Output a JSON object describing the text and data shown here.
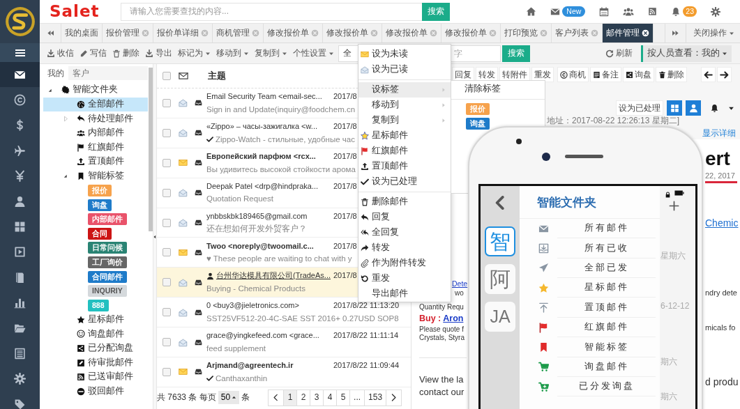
{
  "nav_rail": {
    "items": [
      {
        "selected": true
      },
      {
        "selected": false
      },
      {
        "selected": false
      },
      {
        "selected": false
      },
      {
        "selected": false
      },
      {
        "selected": false
      },
      {
        "selected": false
      },
      {
        "selected": false
      },
      {
        "selected": false
      },
      {
        "selected": false
      },
      {
        "selected": false
      },
      {
        "selected": false
      },
      {
        "selected": false
      },
      {
        "selected": false
      }
    ]
  },
  "header": {
    "logo": "Salet",
    "search": {
      "placeholder": "请输入您需要查找的内容...",
      "button": "搜索"
    },
    "mail_badge": "New",
    "notification_badge": "23"
  },
  "tabs": {
    "items": [
      {
        "label": "我的桌面",
        "closable": false,
        "selected": false
      },
      {
        "label": "报价管理",
        "closable": true,
        "selected": false
      },
      {
        "label": "报价单详细",
        "closable": true,
        "selected": false
      },
      {
        "label": "商机管理",
        "closable": true,
        "selected": false
      },
      {
        "label": "修改报价单",
        "closable": true,
        "selected": false
      },
      {
        "label": "修改报价单",
        "closable": true,
        "selected": false
      },
      {
        "label": "修改报价单",
        "closable": true,
        "selected": false
      },
      {
        "label": "修改报价单",
        "closable": true,
        "selected": false
      },
      {
        "label": "打印预览",
        "closable": true,
        "selected": false
      },
      {
        "label": "客户列表",
        "closable": true,
        "selected": false
      },
      {
        "label": "邮件管理",
        "closable": true,
        "selected": true
      }
    ],
    "menu": "关闭操作"
  },
  "toolbar": {
    "actions": [
      {
        "label": "收信",
        "kind": "icon"
      },
      {
        "label": "写信",
        "kind": "icon"
      },
      {
        "label": "删除",
        "kind": "icon"
      },
      {
        "label": "导出",
        "kind": "icon"
      },
      {
        "label": "标记为",
        "kind": "dropdown"
      },
      {
        "label": "移动到",
        "kind": "dropdown"
      },
      {
        "label": "复制到",
        "kind": "dropdown"
      },
      {
        "label": "个性设置",
        "kind": "dropdown"
      }
    ],
    "scope": "全",
    "search_placeholder": "字",
    "search_button": "搜索",
    "refresh": "刷新",
    "view_filter": "按人员查看：我的"
  },
  "folder_panel": {
    "tabs": [
      {
        "label": "我的",
        "selected": true
      },
      {
        "label": "客户",
        "selected": false
      }
    ],
    "tree": [
      {
        "label": "智能文件夹",
        "kind": "folder",
        "expanded": true,
        "selected": false,
        "children": [
          {
            "label": "全部邮件",
            "kind": "folder",
            "selected": true
          },
          {
            "label": "待处理邮件",
            "kind": "folder",
            "expanded": false,
            "selected": false
          },
          {
            "label": "内部邮件",
            "kind": "folder",
            "selected": false
          },
          {
            "label": "红旗邮件",
            "kind": "folder",
            "selected": false
          },
          {
            "label": "置顶邮件",
            "kind": "folder",
            "selected": false
          },
          {
            "label": "智能标签",
            "kind": "folder",
            "expanded": true,
            "selected": false,
            "children": [
              {
                "label": "报价",
                "kind": "tag",
                "color": "#f6a24c",
                "selected": false
              },
              {
                "label": "询盘",
                "kind": "tag",
                "color": "#1e7bc9",
                "selected": false
              },
              {
                "label": "内部邮件",
                "kind": "tag",
                "color": "#e9536a",
                "selected": false
              },
              {
                "label": "合同",
                "kind": "tag",
                "color": "#cc1414",
                "selected": false
              },
              {
                "label": "日常问候",
                "kind": "tag",
                "color": "#2a8474",
                "selected": false
              },
              {
                "label": "工厂询价",
                "kind": "tag",
                "color": "#666666",
                "selected": false
              },
              {
                "label": "合同邮件",
                "kind": "tag",
                "color": "#1e7bc9",
                "selected": false
              },
              {
                "label": "INQURIY",
                "kind": "tag",
                "color": "#d5d9dc",
                "selected": false
              },
              {
                "label": "888",
                "kind": "tag",
                "color": "#22c0c0",
                "selected": false
              }
            ]
          },
          {
            "label": "星标邮件",
            "kind": "folder",
            "selected": false
          },
          {
            "label": "询盘邮件",
            "kind": "folder",
            "selected": false
          },
          {
            "label": "已分配询盘",
            "kind": "folder",
            "selected": false
          },
          {
            "label": "待审批邮件",
            "kind": "folder",
            "selected": false
          },
          {
            "label": "已送审邮件",
            "kind": "folder",
            "selected": false
          },
          {
            "label": "驳回邮件",
            "kind": "folder",
            "selected": false
          }
        ]
      }
    ]
  },
  "email_list": {
    "header": "主题",
    "header_checkbox": {
      "checked": false
    },
    "rows": [
      {
        "sender": "Email Security Team <email-sec...",
        "date": "2017/8",
        "preview": "Sign in and Update(inquiry@foodchem.cn",
        "unread": false,
        "processed": false,
        "contact": false,
        "checked": false,
        "selected": false
      },
      {
        "sender": "«Zippo» – часы-зажигалка <w...",
        "date": "2017/8",
        "preview": "Zippo-Watch - стильные, удобные час",
        "unread": false,
        "processed": true,
        "contact": false,
        "checked": false,
        "selected": false
      },
      {
        "sender": "Европейский парфюм <rcx...",
        "date": "2017/8",
        "preview": "Вы удивитесь высокой стойкости арома",
        "unread": true,
        "processed": false,
        "contact": false,
        "checked": false,
        "selected": false
      },
      {
        "sender": "Deepak Patel <drp@hindpraka...",
        "date": "2017/8",
        "preview": "Quotation Request",
        "unread": false,
        "processed": false,
        "contact": false,
        "checked": false,
        "selected": false
      },
      {
        "sender": "ynbbskbk189465@gmail.com",
        "date": "2017/8",
        "preview": "还在想如何开发外贸客户？",
        "unread": false,
        "processed": false,
        "contact": false,
        "checked": false,
        "selected": false
      },
      {
        "sender": "Twoo <noreply@twoomail.c...",
        "date": "2017/8",
        "preview": "♥ These people are waiting to chat with y",
        "unread": true,
        "processed": false,
        "contact": false,
        "checked": false,
        "selected": false
      },
      {
        "sender": "台州华达模具有限公司(TradeAs...",
        "date": "2017/8",
        "preview": "Buying - Chemical Products",
        "unread": false,
        "processed": false,
        "contact": true,
        "checked": false,
        "selected": true
      },
      {
        "sender": "0 <buy3@jieletronics.com>",
        "date": "2017/8/22 11:13:20",
        "preview": "SST25VF512-20-4C-SAE SST 2016+ 0.27USD SOP8",
        "unread": false,
        "processed": false,
        "contact": false,
        "checked": false,
        "selected": false
      },
      {
        "sender": "grace@yingkefeed.com <grace...",
        "date": "2017/8/22 11:11:14",
        "preview": "feed supplement",
        "unread": false,
        "processed": false,
        "contact": false,
        "checked": false,
        "selected": false
      },
      {
        "sender": "Arjmand@agreentech.ir",
        "date": "2017/8/22 11:09:44",
        "preview": "Canthaxanthin",
        "unread": true,
        "processed": true,
        "contact": false,
        "checked": false,
        "selected": false
      }
    ],
    "pager": {
      "summary": "共 7633 条 每页",
      "page_size": "50",
      "unit": "条",
      "pages": [
        {
          "label": "1",
          "selected": true
        },
        {
          "label": "2",
          "selected": false
        },
        {
          "label": "3",
          "selected": false
        },
        {
          "label": "4",
          "selected": false
        },
        {
          "label": "5",
          "selected": false
        },
        {
          "label": "...",
          "selected": false
        },
        {
          "label": "153",
          "selected": false
        }
      ]
    }
  },
  "context_menu": {
    "items": [
      {
        "label": "设为未读",
        "kind": "item",
        "selected": false
      },
      {
        "label": "设为已读",
        "kind": "item",
        "selected": false
      },
      {
        "kind": "divider"
      },
      {
        "label": "设标签",
        "kind": "submenu",
        "selected": true
      },
      {
        "label": "移动到",
        "kind": "submenu",
        "selected": false
      },
      {
        "label": "复制到",
        "kind": "submenu",
        "selected": false
      },
      {
        "label": "星标邮件",
        "kind": "item",
        "selected": false
      },
      {
        "label": "红旗邮件",
        "kind": "item",
        "selected": false
      },
      {
        "label": "置顶邮件",
        "kind": "item",
        "selected": false
      },
      {
        "label": "设为已处理",
        "kind": "item",
        "selected": false
      },
      {
        "kind": "divider"
      },
      {
        "label": "删除邮件",
        "kind": "item",
        "selected": false
      },
      {
        "label": "回复",
        "kind": "item",
        "selected": false
      },
      {
        "label": "全回复",
        "kind": "item",
        "selected": false
      },
      {
        "label": "转发",
        "kind": "item",
        "selected": false
      },
      {
        "label": "作为附件转发",
        "kind": "item",
        "selected": false
      },
      {
        "label": "重发",
        "kind": "item",
        "selected": false
      },
      {
        "label": "导出邮件",
        "kind": "item",
        "selected": false
      }
    ]
  },
  "tag_submenu": {
    "items": [
      {
        "label": "清除标签",
        "kind": "item"
      },
      {
        "kind": "divider"
      },
      {
        "label": "报价",
        "kind": "tag",
        "color": "#f6a24c"
      },
      {
        "label": "询盘",
        "kind": "tag",
        "color": "#1e7bc9"
      }
    ]
  },
  "reader": {
    "actions": [
      {
        "label": "回复",
        "kind": "plain"
      },
      {
        "label": "转发",
        "kind": "plain"
      },
      {
        "label": "转附件",
        "kind": "plain"
      },
      {
        "label": "重发",
        "kind": "plain"
      },
      {
        "label": "商机",
        "kind": "icon"
      },
      {
        "label": "备注",
        "kind": "icon"
      },
      {
        "label": "询盘",
        "kind": "icon"
      },
      {
        "label": "删除",
        "kind": "icon"
      }
    ],
    "mark_done": "设为已处理",
    "meta": "地址：2017-08-22 12:26:13 星期二]",
    "details_link": "显示详细",
    "body_left": [
      {
        "text": "Dete",
        "kind": "link"
      },
      {
        "text": "wo",
        "kind": "text"
      },
      {
        "text": "Quantity Requ",
        "kind": "text"
      },
      {
        "kind": "heading",
        "label": "Buy :",
        "link": "Aron"
      },
      {
        "text": "Please quote f",
        "kind": "text"
      },
      {
        "text": "Crystals, Styra",
        "kind": "text"
      },
      {
        "kind": "rule"
      },
      {
        "text": "View the la",
        "kind": "large"
      },
      {
        "text": "contact our",
        "kind": "large"
      }
    ],
    "body_right": [
      {
        "text": "ert",
        "kind": "title"
      },
      {
        "text": "22, 2017",
        "kind": "date"
      },
      {
        "kind": "accent_rule"
      },
      {
        "text": "Chemic",
        "kind": "link"
      },
      {
        "text": "ndry dete",
        "kind": "text"
      },
      {
        "text": "micals fo",
        "kind": "text"
      },
      {
        "text": "d produ",
        "kind": "large"
      }
    ]
  },
  "phone": {
    "title": "智能文件夹",
    "side_tabs": [
      {
        "label": "智",
        "selected": true
      },
      {
        "label": "阿",
        "selected": false
      },
      {
        "label": "JA",
        "selected": false
      }
    ],
    "items": [
      {
        "label": "所有邮件"
      },
      {
        "label": "所有已收"
      },
      {
        "label": "全部已发"
      },
      {
        "label": "星标邮件"
      },
      {
        "label": "置顶邮件"
      },
      {
        "label": "红旗邮件"
      },
      {
        "label": "智能标签"
      },
      {
        "label": "询盘邮件"
      },
      {
        "label": "已分发询盘"
      }
    ],
    "background_texts": [
      "星期六",
      "6-12-12",
      "期六",
      "期六"
    ]
  }
}
